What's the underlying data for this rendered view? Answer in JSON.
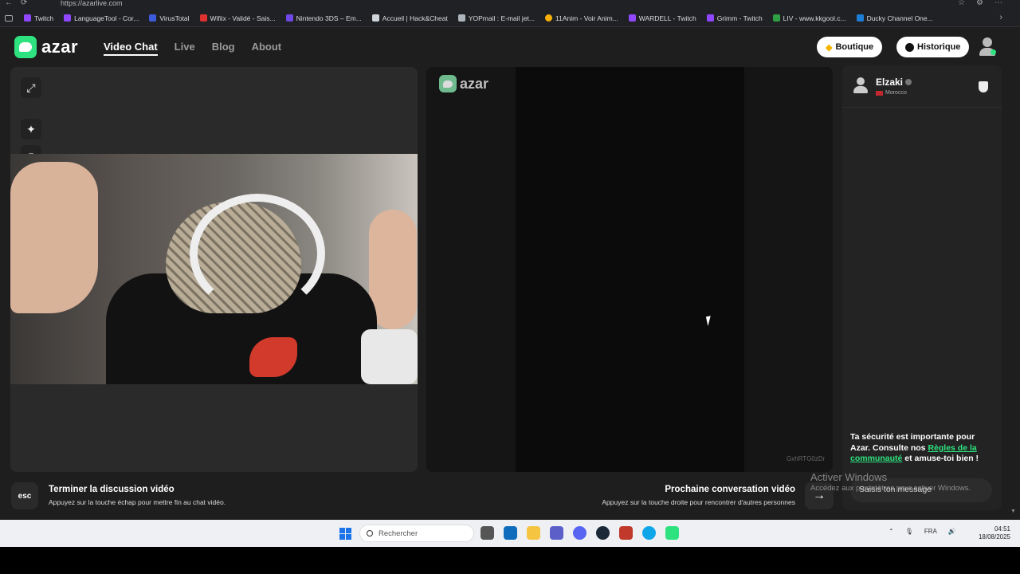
{
  "browser": {
    "url": "https://azarlive.com",
    "bookmarks": [
      {
        "label": "Twitch",
        "color": "#9146ff"
      },
      {
        "label": "LanguageTool - Cor...",
        "color": "#9146ff"
      },
      {
        "label": "VirusTotal",
        "color": "#3b5bdb"
      },
      {
        "label": "Wifiix - Validé - Sais...",
        "color": "#e03131"
      },
      {
        "label": "Nintendo 3DS – Em...",
        "color": "#7048e8"
      },
      {
        "label": "Accueil | Hack&Cheat",
        "color": "#ced4da"
      },
      {
        "label": "YOPmail : E-mail jet...",
        "color": "#adb5bd"
      },
      {
        "label": "11Anim - Voir Anim...",
        "color": "#fab005"
      },
      {
        "label": "WARDELL - Twitch",
        "color": "#9146ff"
      },
      {
        "label": "Grimm - Twitch",
        "color": "#9146ff"
      },
      {
        "label": "LIV - www.kkgool.c...",
        "color": "#2f9e44"
      },
      {
        "label": "Ducky Channel One...",
        "color": "#1c7ed6"
      }
    ]
  },
  "header": {
    "logo": "azar",
    "nav": [
      {
        "label": "Video Chat",
        "active": true
      },
      {
        "label": "Live",
        "active": false
      },
      {
        "label": "Blog",
        "active": false
      },
      {
        "label": "About",
        "active": false
      }
    ],
    "shop_label": "Boutique",
    "history_label": "Historique",
    "accent_color": "#2ee37f"
  },
  "partner": {
    "logo": "azar",
    "session_code": "GxhRTG0zDr"
  },
  "chat": {
    "user_name": "Elzaki",
    "country": "Morocco",
    "notice_prefix": "Ta sécurité est importante pour Azar. Consulte nos ",
    "notice_link": "Règles de la communauté",
    "notice_suffix": " et amuse-toi bien !",
    "input_placeholder": "Saisis ton message"
  },
  "controls": {
    "esc_label": "esc",
    "end_title": "Terminer la discussion vidéo",
    "end_subtitle": "Appuyez sur la touche échap pour mettre fin au chat vidéo.",
    "next_title": "Prochaine conversation vidéo",
    "next_subtitle": "Appuyez sur la touche droite pour rencontrer d'autres personnes",
    "next_arrow": "→"
  },
  "watermark": {
    "line1": "Activer Windows",
    "line2": "Accédez aux paramètres pour activer Windows."
  },
  "taskbar": {
    "search_placeholder": "Rechercher",
    "language": "FRA",
    "time": "04:51",
    "date": "18/08/2025"
  }
}
